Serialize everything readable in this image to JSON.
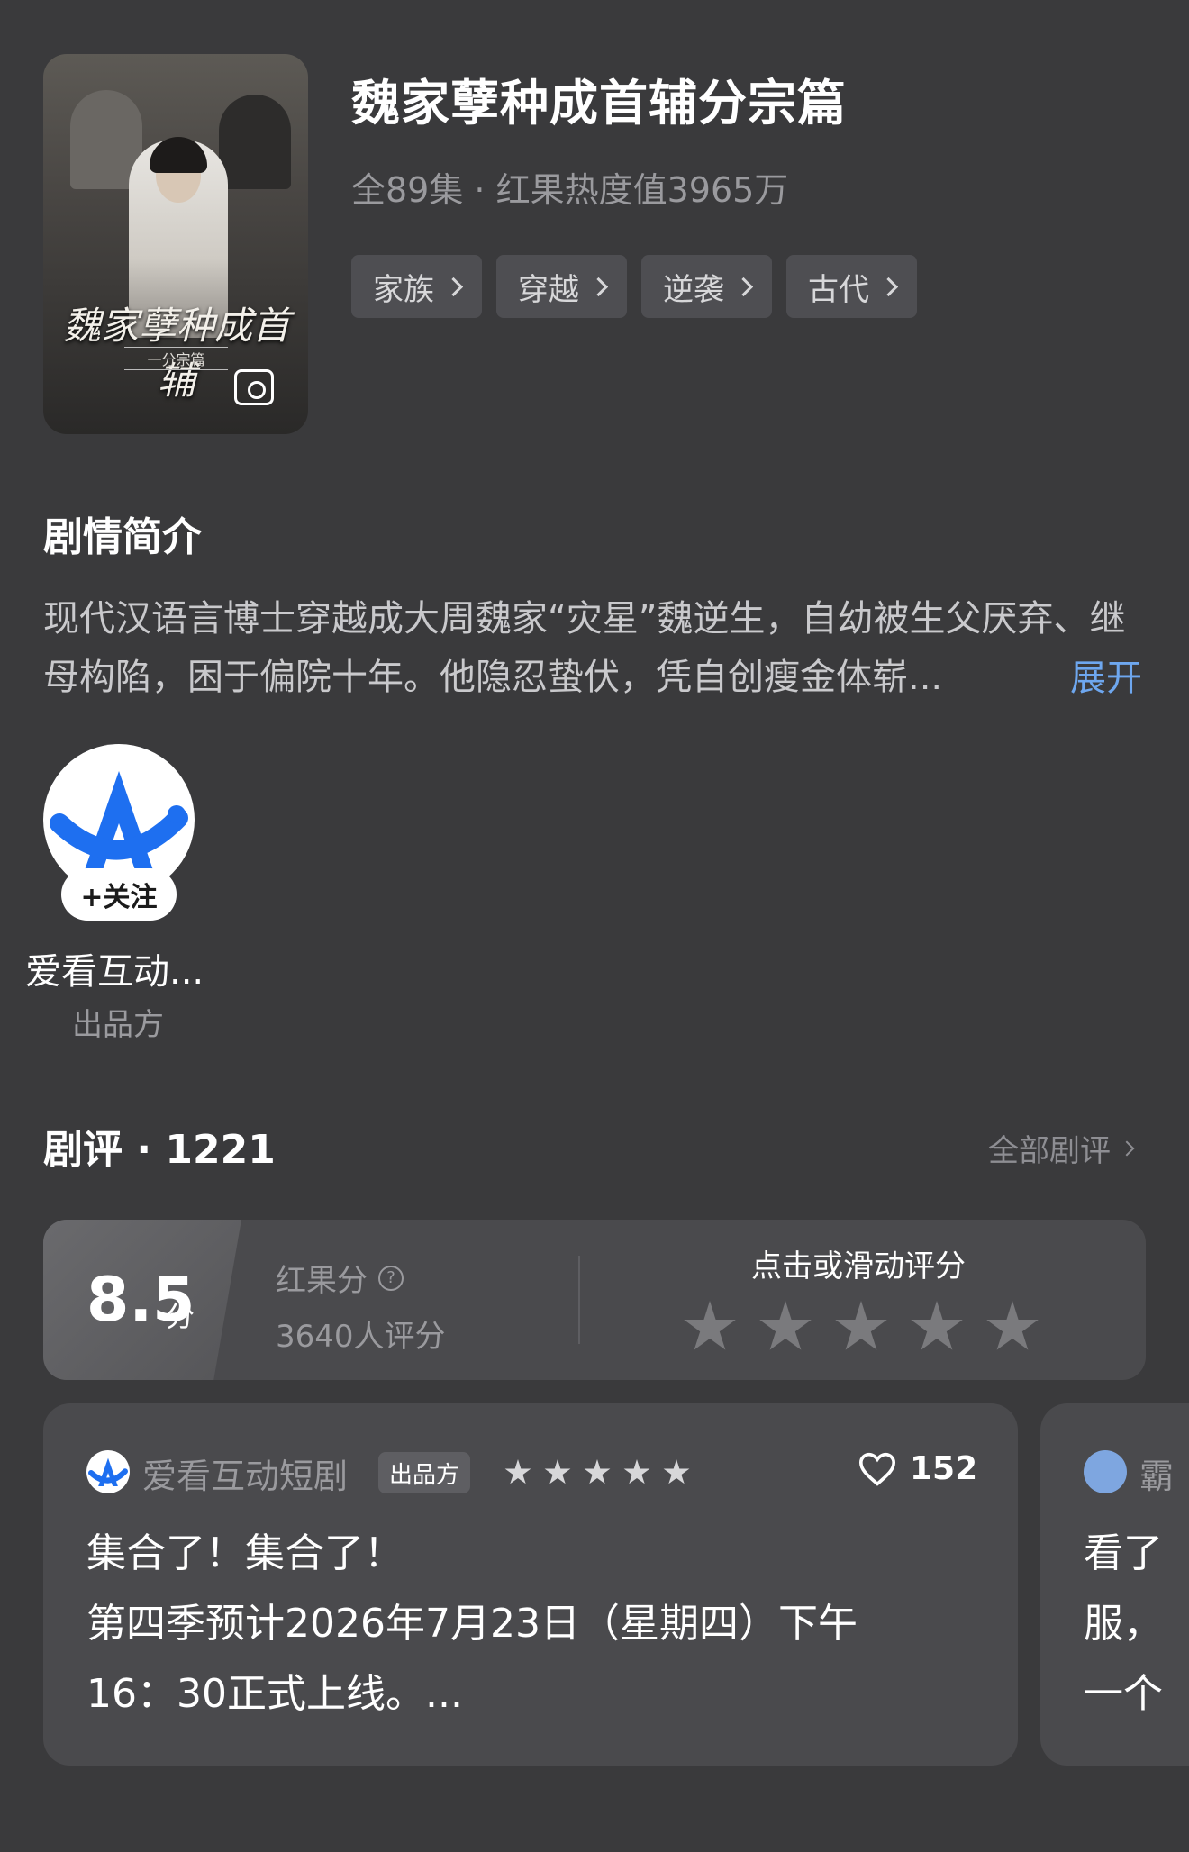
{
  "show": {
    "title": "魏家孽种成首辅分宗篇",
    "meta": "全89集 · 红果热度值3965万",
    "poster_title": "魏家孽种成首辅",
    "poster_subtitle": "一分宗篇",
    "tags": [
      "家族",
      "穿越",
      "逆袭",
      "古代"
    ]
  },
  "synopsis": {
    "heading": "剧情简介",
    "text": "现代汉语言博士穿越成大周魏家“灾星”魏逆生，自幼被生父厌弃、继母构陷，困于偏院十年。他隐忍蛰伏，凭自创瘦金体崭...",
    "expand_label": "展开"
  },
  "producer": {
    "follow_label": "+关注",
    "name": "爱看互动...",
    "role": "出品方",
    "logo_color": "#1e6ff0"
  },
  "reviews": {
    "heading": "剧评 · 1221",
    "all_label": "全部剧评",
    "score": "8.5",
    "score_unit": "分",
    "score_label": "红果分",
    "rating_count": "3640人评分",
    "rate_prompt": "点击或滑动评分",
    "items": [
      {
        "user": "爱看互动短剧",
        "badge": "出品方",
        "stars": 5,
        "likes": "152",
        "text_lines": [
          "集合了！集合了！",
          "第四季预计2026年7月23日（星期四）下午",
          "16：30正式上线。..."
        ]
      },
      {
        "user": "霸",
        "text_lines": [
          "看了",
          "服，",
          "一个"
        ]
      }
    ]
  }
}
